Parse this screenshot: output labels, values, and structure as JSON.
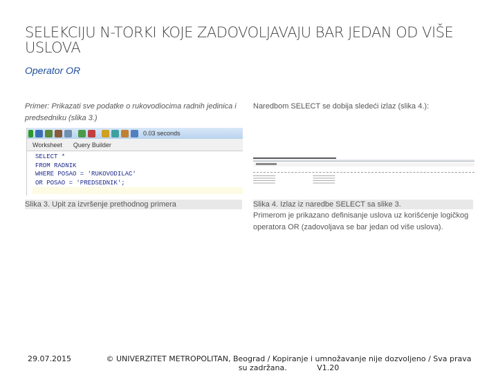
{
  "title": "SELEKCIJU N-TORKI KOJE ZADOVOLJAVAJU BAR JEDAN OD VIŠE USLOVA",
  "subtitle": "Operator OR",
  "left": {
    "intro": "Primer: Prikazati sve podatke o rukovodiocima radnih jedinica i predsedniku (slika 3.)",
    "toolbar_time": "0.03 seconds",
    "tabs": [
      "Worksheet",
      "Query Builder"
    ],
    "code": [
      "SELECT *",
      "FROM RADNIK",
      "WHERE POSAO = 'RUKOVODILAC'",
      "OR POSAO = 'PREDSEDNIK';"
    ],
    "caption": "Slika 3. Upit za izvršenje prethodnog primera"
  },
  "right": {
    "intro": "Naredbom SELECT se dobija sledeći izlaz (slika 4.):",
    "caption": "Slika 4. Izlaz iz naredbe SELECT sa slike 3.",
    "description": "Primerom je prikazano definisanje uslova uz korišćenje logičkog operatora OR (zadovoljava se bar jedan od više uslova)."
  },
  "footer": {
    "date": "29.07.2015",
    "copyright": "© UNIVERZITET METROPOLITAN, Beograd / Kopiranje i umnožavanje nije dozvoljeno / Sva prava su zadržana.",
    "version": "V1.20"
  }
}
